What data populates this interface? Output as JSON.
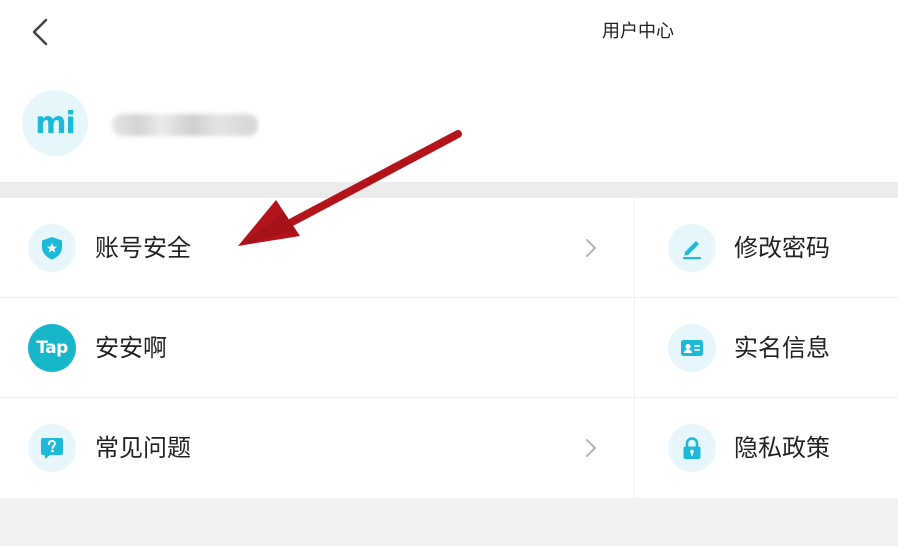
{
  "header": {
    "title": "用户中心"
  },
  "profile": {
    "avatar_text": "mi"
  },
  "menu": {
    "left": [
      {
        "label": "账号安全",
        "icon": "shield-star-icon",
        "chevron": true
      },
      {
        "label": "安安啊",
        "icon": "taptap-logo-icon",
        "chevron": false
      },
      {
        "label": "常见问题",
        "icon": "question-bubble-icon",
        "chevron": true
      }
    ],
    "right": [
      {
        "label": "修改密码",
        "icon": "pencil-icon"
      },
      {
        "label": "实名信息",
        "icon": "id-card-icon"
      },
      {
        "label": "隐私政策",
        "icon": "lock-icon"
      }
    ]
  },
  "taptap_logo_text": "Tap",
  "colors": {
    "accent": "#1cb9d9",
    "icon_bg": "#e6f6fa",
    "annotation_arrow": "#b3141c"
  }
}
